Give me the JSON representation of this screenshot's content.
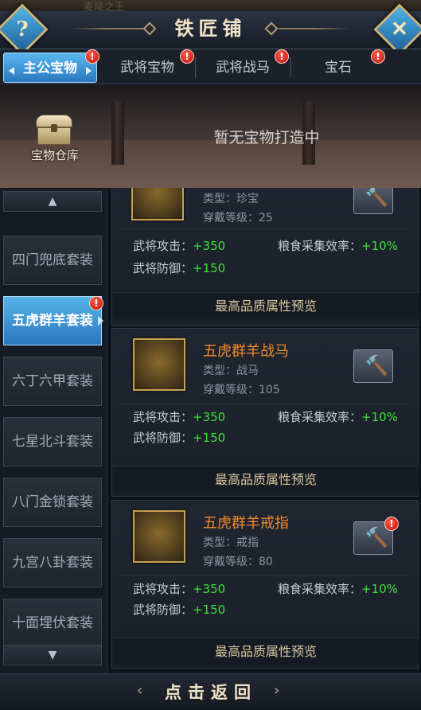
{
  "window": {
    "bg_hint": "麦陵之王",
    "title": "铁匠铺"
  },
  "tabs": [
    {
      "label": "主公宝物",
      "active": true,
      "badge": "!"
    },
    {
      "label": "武将宝物",
      "active": false,
      "badge": "!"
    },
    {
      "label": "武将战马",
      "active": false,
      "badge": "!"
    },
    {
      "label": "宝石",
      "active": false,
      "badge": "!"
    }
  ],
  "banner": {
    "warehouse_label": "宝物仓库",
    "empty_message": "暂无宝物打造中"
  },
  "sidebar": {
    "items": [
      {
        "label": "四门兜底套装"
      },
      {
        "label": "五虎群羊套装",
        "badge": "!"
      },
      {
        "label": "六丁六甲套装"
      },
      {
        "label": "七星北斗套装"
      },
      {
        "label": "八门金锁套装"
      },
      {
        "label": "九宫八卦套装"
      },
      {
        "label": "十面埋伏套装"
      }
    ]
  },
  "items": [
    {
      "name": "",
      "type": "类型：珍宝",
      "level": "穿戴等级：25",
      "attack_label": "武将攻击：",
      "attack_value": "+350",
      "defense_label": "武将防御：",
      "defense_value": "+150",
      "gather_label": "粮食采集效率：",
      "gather_value": "+10%",
      "preview": "最高品质属性预览"
    },
    {
      "name": "五虎群羊战马",
      "type": "类型：战马",
      "level": "穿戴等级：105",
      "attack_label": "武将攻击：",
      "attack_value": "+350",
      "defense_label": "武将防御：",
      "defense_value": "+150",
      "gather_label": "粮食采集效率：",
      "gather_value": "+10%",
      "preview": "最高品质属性预览"
    },
    {
      "name": "五虎群羊戒指",
      "type": "类型：戒指",
      "level": "穿戴等级：80",
      "attack_label": "武将攻击：",
      "attack_value": "+350",
      "defense_label": "武将防御：",
      "defense_value": "+150",
      "gather_label": "粮食采集效率：",
      "gather_value": "+10%",
      "preview": "最高品质属性预览",
      "badge": "!"
    }
  ],
  "footer": {
    "back_label": "点击返回"
  },
  "icons": {
    "help": "?",
    "close": "✕",
    "left": "‹",
    "right": "›"
  },
  "colors": {
    "accent": "#3a8fd6",
    "stat_value": "#3fe03a",
    "item_name": "#f08a2c",
    "badge": "#d2261a"
  }
}
